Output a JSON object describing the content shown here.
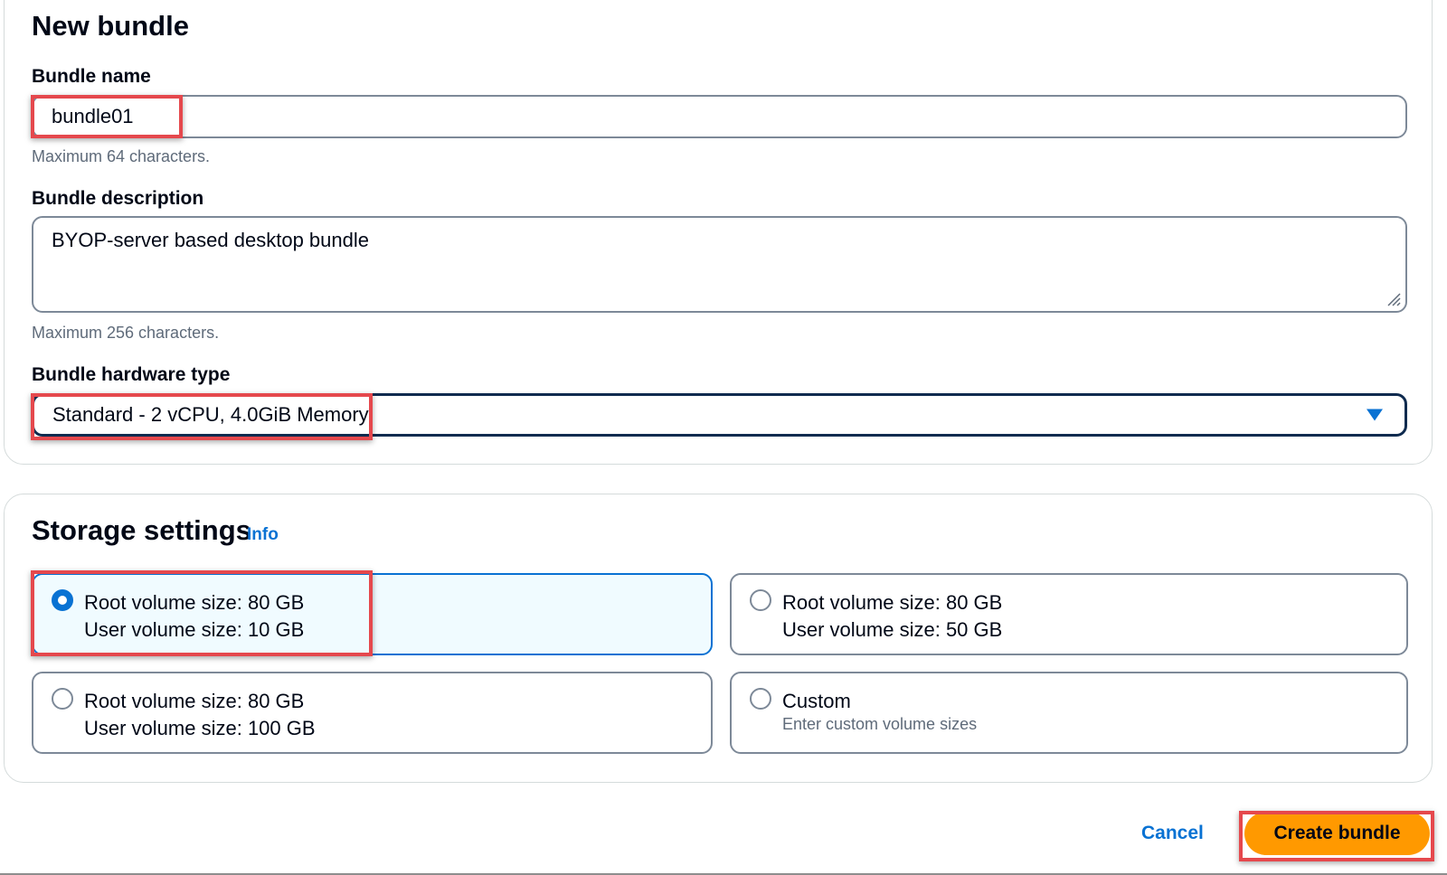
{
  "new_bundle": {
    "title": "New bundle",
    "bundle_name": {
      "label": "Bundle name",
      "value": "bundle01",
      "hint": "Maximum 64 characters."
    },
    "bundle_description": {
      "label": "Bundle description",
      "value": "BYOP-server based desktop bundle",
      "hint": "Maximum 256 characters."
    },
    "hardware_type": {
      "label": "Bundle hardware type",
      "selected": "Standard - 2 vCPU, 4.0GiB Memory"
    }
  },
  "storage": {
    "title": "Storage settings",
    "info_link": "Info",
    "options": [
      {
        "line1": "Root volume size: 80 GB",
        "line2": "User volume size: 10 GB",
        "selected": true
      },
      {
        "line1": "Root volume size: 80 GB",
        "line2": "User volume size: 50 GB",
        "selected": false
      },
      {
        "line1": "Root volume size: 80 GB",
        "line2": "User volume size: 100 GB",
        "selected": false
      },
      {
        "line1": "Custom",
        "line2": "Enter custom volume sizes",
        "selected": false
      }
    ]
  },
  "footer": {
    "cancel_label": "Cancel",
    "create_label": "Create bundle"
  },
  "colors": {
    "accent": "#0972d3",
    "primary_button": "#ff9900",
    "highlight": "#e5484d"
  }
}
